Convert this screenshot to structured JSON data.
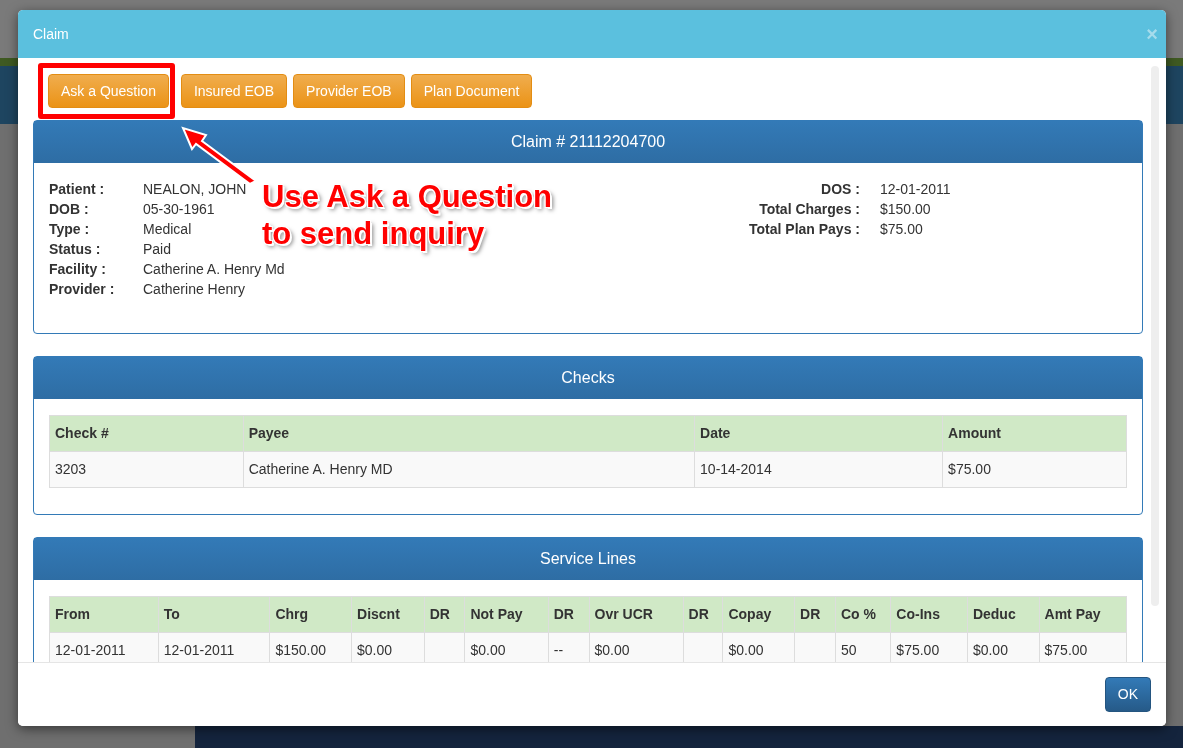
{
  "modal": {
    "title": "Claim",
    "close": "×"
  },
  "actions": [
    {
      "label": "Ask a Question"
    },
    {
      "label": "Insured EOB"
    },
    {
      "label": "Provider EOB"
    },
    {
      "label": "Plan Document"
    }
  ],
  "annotation": {
    "text": "Use Ask a Question to send inquiry"
  },
  "claim": {
    "title": "Claim # 21112204700",
    "left_fields": [
      {
        "label": "Patient :",
        "value": "NEALON, JOHN"
      },
      {
        "label": "DOB :",
        "value": "05-30-1961"
      },
      {
        "label": "Type :",
        "value": "Medical"
      },
      {
        "label": "Status :",
        "value": "Paid"
      },
      {
        "label": "Facility :",
        "value": "Catherine A. Henry Md"
      },
      {
        "label": "Provider :",
        "value": "Catherine Henry"
      }
    ],
    "right_fields": [
      {
        "label": "DOS :",
        "value": "12-01-2011"
      },
      {
        "label": "Total Charges :",
        "value": "$150.00"
      },
      {
        "label": "Total Plan Pays :",
        "value": "$75.00"
      }
    ]
  },
  "checks": {
    "title": "Checks",
    "columns": [
      "Check #",
      "Payee",
      "Date",
      "Amount"
    ],
    "rows": [
      [
        "3203",
        "Catherine A. Henry MD",
        "10-14-2014",
        "$75.00"
      ]
    ]
  },
  "service_lines": {
    "title": "Service Lines",
    "columns": [
      "From",
      "To",
      "Chrg",
      "Discnt",
      "DR",
      "Not Pay",
      "DR",
      "Ovr UCR",
      "DR",
      "Copay",
      "DR",
      "Co %",
      "Co-Ins",
      "Deduc",
      "Amt Pay"
    ],
    "rows": [
      [
        "12-01-2011",
        "12-01-2011",
        "$150.00",
        "$0.00",
        "",
        "$0.00",
        "--",
        "$0.00",
        "",
        "$0.00",
        "",
        "50",
        "$75.00",
        "$0.00",
        "$75.00"
      ]
    ]
  },
  "footer": {
    "button": "OK"
  }
}
